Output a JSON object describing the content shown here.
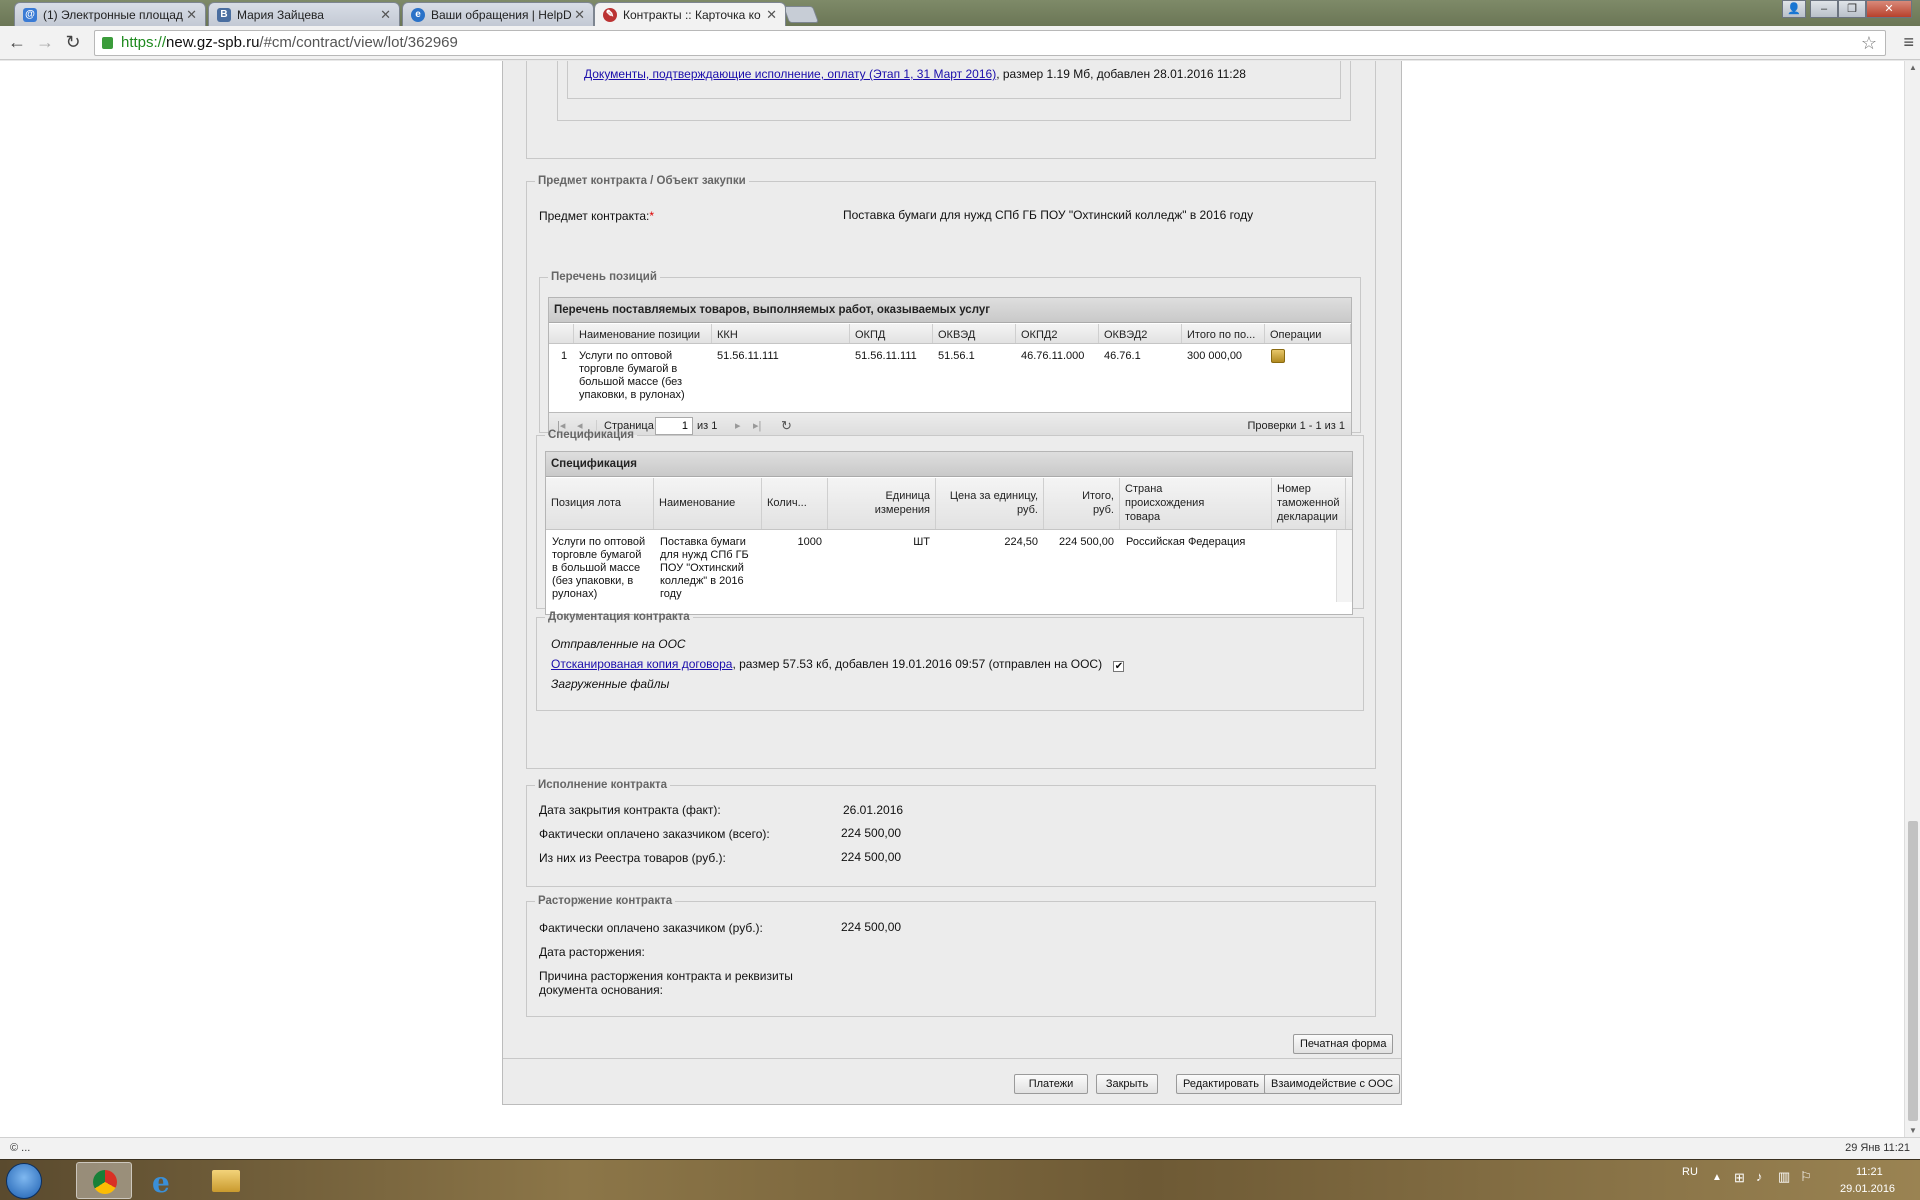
{
  "browser": {
    "tabs": [
      {
        "label": "(1) Электронные площад",
        "icon": "mail-icon"
      },
      {
        "label": "Мария Зайцева",
        "icon": "vk-icon"
      },
      {
        "label": "Ваши обращения | HelpD",
        "icon": "globe-icon"
      },
      {
        "label": "Контракты :: Карточка ко",
        "icon": "tools-icon",
        "active": true
      }
    ],
    "url_prefix": "https://",
    "url_host": "new.gz-spb.ru",
    "url_path": "/#cm/contract/view/lot/362969"
  },
  "top_doc": {
    "link": "Документы, подтверждающие исполнение, оплату (Этап 1, 31 Март 2016)",
    "info": ", размер 1.19 Мб, добавлен 28.01.2016 11:28"
  },
  "subject": {
    "legend": "Предмет контракта / Объект закупки",
    "label": "Предмет контракта:",
    "required": "*",
    "value": "Поставка бумаги для нужд СПб ГБ ПОУ \"Охтинский колледж\" в 2016 году"
  },
  "positions": {
    "legend": "Перечень позиций",
    "grid_title": "Перечень поставляемых товаров, выполняемых работ, оказываемых услуг",
    "columns": [
      "Наименование позиции",
      "ККН",
      "ОКПД",
      "ОКВЭД",
      "ОКПД2",
      "ОКВЭД2",
      "Итого по по...",
      "Операции"
    ],
    "row": {
      "num": "1",
      "name": "Услуги по оптовой торговле бумагой в большой массе (без упаковки, в рулонах)",
      "kkn": "51.56.11.111",
      "okpd": "51.56.11.111",
      "okved": "51.56.1",
      "okpd2": "46.76.11.000",
      "okved2": "46.76.1",
      "total": "300 000,00"
    },
    "pager": {
      "page_label": "Страница",
      "page": "1",
      "of": "из 1",
      "summary": "Проверки 1 - 1 из 1"
    }
  },
  "spec": {
    "legend": "Спецификация",
    "grid_title": "Спецификация",
    "columns": [
      "Позиция лота",
      "Наименование",
      "Колич...",
      "Единица измерения",
      "Цена за единицу, руб.",
      "Итого, руб.",
      "Страна происхождения товара",
      "Номер таможенной декларации"
    ],
    "row": {
      "position": "Услуги по оптовой торговле бумагой в большой массе (без упаковки, в рулонах)",
      "name": "Поставка бумаги для нужд СПб ГБ ПОУ \"Охтинский колледж\" в 2016 году",
      "qty": "1000",
      "unit": "ШТ",
      "price": "224,50",
      "total": "224 500,00",
      "country": "Российская Федерация",
      "decl": ""
    }
  },
  "docs": {
    "legend": "Документация контракта",
    "sent_label": "Отправленные на ООС",
    "file_link": "Отсканированая копия договора",
    "file_info": ", размер 57.53 кб, добавлен 19.01.2016 09:57 (отправлен на ООС)",
    "uploaded_label": "Загруженные файлы"
  },
  "execution": {
    "legend": "Исполнение контракта",
    "rows": [
      {
        "label": "Дата закрытия контракта (факт):",
        "value": "26.01.2016"
      },
      {
        "label": "Фактически оплачено заказчиком (всего):",
        "value": "224 500,00"
      },
      {
        "label": "Из них из Реестра товаров (руб.):",
        "value": "224 500,00"
      }
    ]
  },
  "termination": {
    "legend": "Расторжение контракта",
    "rows": [
      {
        "label": "Фактически оплачено заказчиком (руб.):",
        "value": "224 500,00"
      },
      {
        "label": "Дата расторжения:",
        "value": ""
      },
      {
        "label": "Причина расторжения контракта и реквизиты документа основания:",
        "value": ""
      }
    ]
  },
  "buttons": {
    "print": "Печатная форма",
    "payments": "Платежи",
    "close": "Закрыть",
    "edit": "Редактировать",
    "oos": "Взаимодействие с ООС"
  },
  "statusbar": {
    "left": "© ...",
    "right": "29 Янв 11:21"
  },
  "taskbar": {
    "lang": "RU",
    "time": "11:21",
    "date": "29.01.2016"
  }
}
